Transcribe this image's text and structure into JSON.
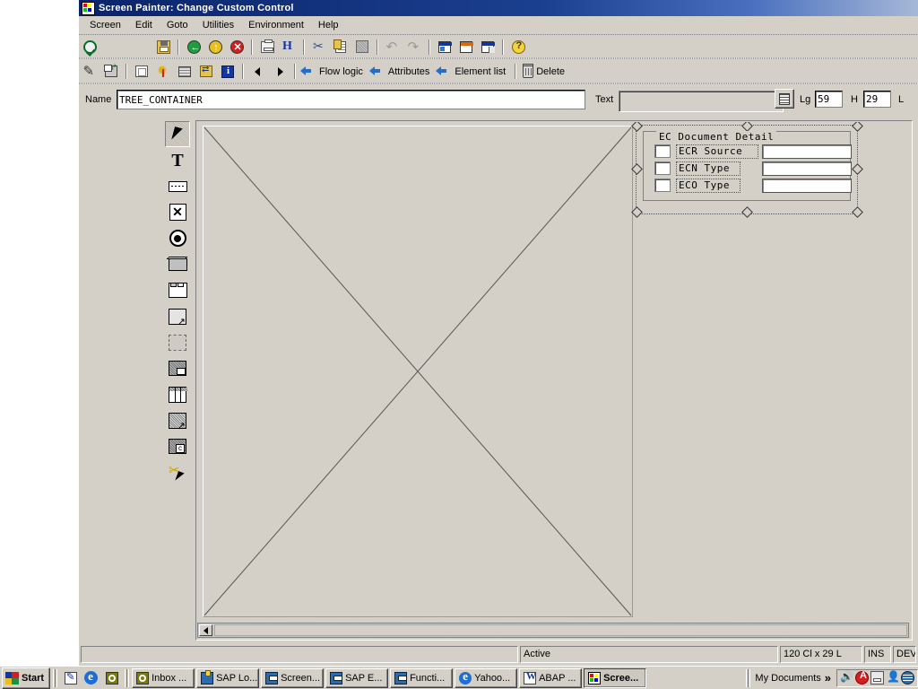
{
  "window": {
    "title": "Screen Painter: Change Custom Control",
    "icon": "sap-screen-painter-icon"
  },
  "menu": {
    "items": [
      {
        "label": "Screen"
      },
      {
        "label": "Edit"
      },
      {
        "label": "Goto"
      },
      {
        "label": "Utilities"
      },
      {
        "label": "Environment"
      },
      {
        "label": "Help"
      }
    ]
  },
  "toolbar_primary": {
    "buttons": [
      {
        "name": "enter-check-button",
        "icon": "green-check-icon",
        "label": ""
      },
      {
        "name": "save-button",
        "icon": "save-disk-icon",
        "label": ""
      },
      {
        "name": "back-button",
        "icon": "green-back-arrow-icon",
        "label": ""
      },
      {
        "name": "exit-button",
        "icon": "yellow-up-arrow-icon",
        "label": ""
      },
      {
        "name": "cancel-button",
        "icon": "red-cross-icon",
        "label": ""
      },
      {
        "name": "print-button",
        "icon": "printer-icon",
        "label": ""
      },
      {
        "name": "find-button",
        "icon": "find-icon",
        "label": ""
      },
      {
        "name": "cut-button",
        "icon": "scissors-icon",
        "label": ""
      },
      {
        "name": "copy-button",
        "icon": "copy-icon",
        "label": ""
      },
      {
        "name": "paste-button",
        "icon": "paste-icon",
        "label": ""
      },
      {
        "name": "undo-button",
        "icon": "undo-arrow-icon",
        "label": ""
      },
      {
        "name": "redo-button",
        "icon": "redo-arrow-icon",
        "label": ""
      },
      {
        "name": "layout-window-button",
        "icon": "window-blue-icon",
        "label": ""
      },
      {
        "name": "attributes-window-button",
        "icon": "window-orange-icon",
        "label": ""
      },
      {
        "name": "fullscreen-window-button",
        "icon": "window-split-icon",
        "label": ""
      },
      {
        "name": "help-button",
        "icon": "question-bulb-icon",
        "label": ""
      }
    ]
  },
  "toolbar_secondary": {
    "buttons": [
      {
        "name": "edit-pencil-button",
        "icon": "pencil-icon",
        "label": ""
      },
      {
        "name": "new-window-button",
        "icon": "new-window-icon",
        "label": ""
      },
      {
        "name": "generate-button",
        "icon": "generate-icon",
        "label": ""
      },
      {
        "name": "wizard-button",
        "icon": "wizard-star-icon",
        "label": ""
      },
      {
        "name": "screen-button",
        "icon": "screen-icon",
        "label": ""
      },
      {
        "name": "reposition-button",
        "icon": "move-icon",
        "label": ""
      },
      {
        "name": "info-button",
        "icon": "info-icon",
        "label": ""
      },
      {
        "name": "previous-button",
        "icon": "left-triangle-icon",
        "label": ""
      },
      {
        "name": "next-button",
        "icon": "right-triangle-icon",
        "label": ""
      },
      {
        "name": "flow-logic-button",
        "icon": "green-left-arrow-icon",
        "label": "Flow logic"
      },
      {
        "name": "attributes-button",
        "icon": "green-left-arrow-icon",
        "label": "Attributes"
      },
      {
        "name": "element-list-button",
        "icon": "green-left-arrow-icon",
        "label": "Element list"
      },
      {
        "name": "delete-button",
        "icon": "trash-icon",
        "label": "Delete"
      }
    ]
  },
  "properties": {
    "name_label": "Name",
    "name_value": "TREE_CONTAINER",
    "text_label": "Text",
    "text_value": "",
    "text_placeholder": "",
    "dict_button_icon": "dictionary-icon",
    "lg_label": "Lg",
    "lg_value": "59",
    "h_label": "H",
    "h_value": "29",
    "l_label": "L"
  },
  "palette": {
    "tools": [
      {
        "name": "pointer-tool",
        "icon": "pointer-arrow-icon",
        "selected": true
      },
      {
        "name": "text-field-tool",
        "icon": "text-t-icon",
        "selected": false
      },
      {
        "name": "input-output-field-tool",
        "icon": "input-field-icon",
        "selected": false
      },
      {
        "name": "checkbox-tool",
        "icon": "checkbox-x-icon",
        "selected": false
      },
      {
        "name": "radio-button-tool",
        "icon": "radio-button-icon",
        "selected": false
      },
      {
        "name": "pushbutton-tool",
        "icon": "pushbutton-icon",
        "selected": false
      },
      {
        "name": "tabstrip-tool",
        "icon": "tabstrip-icon",
        "selected": false
      },
      {
        "name": "subscreen-tool",
        "icon": "subscreen-icon",
        "selected": false
      },
      {
        "name": "box-tool",
        "icon": "box-frame-icon",
        "selected": false
      },
      {
        "name": "status-icon-tool",
        "icon": "status-icon",
        "selected": false
      },
      {
        "name": "table-control-tool",
        "icon": "table-control-icon",
        "selected": false
      },
      {
        "name": "custom-control-tool",
        "icon": "custom-control-icon",
        "selected": false
      },
      {
        "name": "container-tool",
        "icon": "container-c-icon",
        "selected": false
      },
      {
        "name": "drag-drop-tool",
        "icon": "drag-drop-icon",
        "selected": false
      }
    ]
  },
  "canvas": {
    "custom_control": {
      "name": "custom-control-placeholder",
      "description": ""
    },
    "group_box": {
      "title": "EC Document Detail",
      "selected": true,
      "rows": [
        {
          "checkbox": "",
          "label": "ECR Source",
          "value": ""
        },
        {
          "checkbox": "",
          "label": "ECN Type",
          "value": ""
        },
        {
          "checkbox": "",
          "label": "ECO Type",
          "value": ""
        }
      ]
    }
  },
  "status_bar": {
    "message": "",
    "state": "Active",
    "size": "120 Cl x 29 L",
    "insert_mode": "INS",
    "system": "DEV"
  },
  "taskbar": {
    "start_label": "Start",
    "quick_launch": [
      {
        "name": "quicklaunch-notes",
        "icon": "notepad-icon"
      },
      {
        "name": "quicklaunch-ie",
        "icon": "internet-explorer-icon"
      },
      {
        "name": "quicklaunch-lotus",
        "icon": "lotus-notes-icon"
      }
    ],
    "tasks": [
      {
        "label": "Inbox ...",
        "icon": "lotus-notes-icon",
        "active": false
      },
      {
        "label": "SAP Lo...",
        "icon": "sap-logon-icon",
        "active": false
      },
      {
        "label": "Screen...",
        "icon": "sap-gui-icon",
        "active": false
      },
      {
        "label": "SAP E...",
        "icon": "sap-gui-icon",
        "active": false
      },
      {
        "label": "Functi...",
        "icon": "sap-gui-icon",
        "active": false
      },
      {
        "label": "Yahoo...",
        "icon": "internet-explorer-icon",
        "active": false
      },
      {
        "label": "ABAP ...",
        "icon": "word-icon",
        "active": false
      },
      {
        "label": "Scree...",
        "icon": "sap-screen-painter-icon",
        "active": true
      }
    ],
    "toolbar_label": "My Documents",
    "chevron": "»",
    "tray": [
      {
        "name": "tray-volume-icon"
      },
      {
        "name": "tray-ati-icon"
      },
      {
        "name": "tray-printer-icon"
      },
      {
        "name": "tray-user-icon"
      },
      {
        "name": "tray-network-icon"
      }
    ]
  }
}
